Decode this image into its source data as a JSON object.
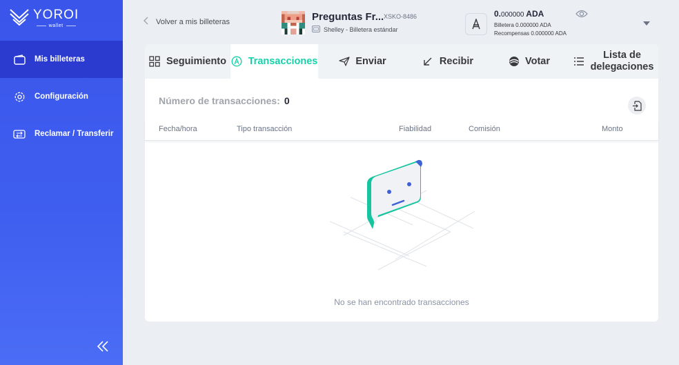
{
  "logo": {
    "name": "YOROI",
    "sub": "wallet"
  },
  "sidebar": {
    "items": [
      {
        "label": "Mis billeteras",
        "icon": "wallet-icon",
        "active": true
      },
      {
        "label": "Configuración",
        "icon": "gear-icon",
        "active": false
      },
      {
        "label": "Reclamar / Transferir",
        "icon": "transfer-icon",
        "active": false
      }
    ],
    "collapse_icon": "double-chevron-left-icon"
  },
  "header": {
    "back_label": "Volver a mis billeteras",
    "wallet_name": "Preguntas Fr...",
    "wallet_plate": "XSKO-8486",
    "wallet_type": "Shelley - Billetera estándar",
    "balance_int": "0.",
    "balance_dec": "000000",
    "balance_unit": "ADA",
    "wallet_balance": "Billetera 0.000000 ADA",
    "rewards_balance": "Recompensas 0.000000 ADA"
  },
  "tabs": [
    {
      "label": "Seguimiento",
      "icon": "dashboard-icon"
    },
    {
      "label": "Transacciones",
      "icon": "ada-circle-icon",
      "active": true
    },
    {
      "label": "Enviar",
      "icon": "send-icon"
    },
    {
      "label": "Recibir",
      "icon": "receive-icon"
    },
    {
      "label": "Votar",
      "icon": "vote-icon"
    },
    {
      "label_line1": "Lista de",
      "label_line2": "delegaciones",
      "icon": "list-icon"
    }
  ],
  "transactions": {
    "count_label": "Número de transacciones:",
    "count_value": "0",
    "columns": [
      "Fecha/hora",
      "Tipo transacción",
      "Fiabilidad",
      "Comisión",
      "Monto"
    ],
    "empty_text": "No se han encontrado transacciones"
  },
  "colors": {
    "sidebar": "#3f5ff0",
    "sidebar_active": "#2b3bd0",
    "accent": "#17d1aa"
  }
}
